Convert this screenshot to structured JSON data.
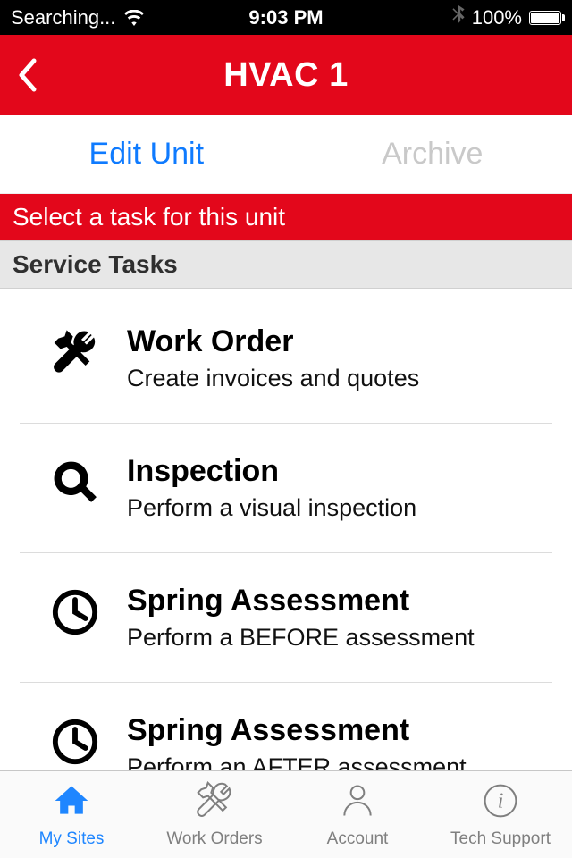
{
  "status": {
    "carrier": "Searching...",
    "time": "9:03 PM",
    "battery_pct": "100%"
  },
  "header": {
    "title": "HVAC 1"
  },
  "actions": {
    "edit": "Edit Unit",
    "archive": "Archive"
  },
  "banner": "Select a task for this unit",
  "section_header": "Service Tasks",
  "tasks": [
    {
      "icon": "tools-icon",
      "title": "Work Order",
      "subtitle": "Create invoices and quotes"
    },
    {
      "icon": "search-icon",
      "title": "Inspection",
      "subtitle": "Perform a visual inspection"
    },
    {
      "icon": "clock-icon",
      "title": "Spring Assessment",
      "subtitle": "Perform a BEFORE assessment"
    },
    {
      "icon": "clock-icon",
      "title": "Spring Assessment",
      "subtitle": "Perform an AFTER assessment"
    }
  ],
  "tabs": [
    {
      "icon": "home-icon",
      "label": "My Sites",
      "active": true
    },
    {
      "icon": "tools-outline-icon",
      "label": "Work Orders",
      "active": false
    },
    {
      "icon": "person-icon",
      "label": "Account",
      "active": false
    },
    {
      "icon": "info-icon",
      "label": "Tech Support",
      "active": false
    }
  ]
}
